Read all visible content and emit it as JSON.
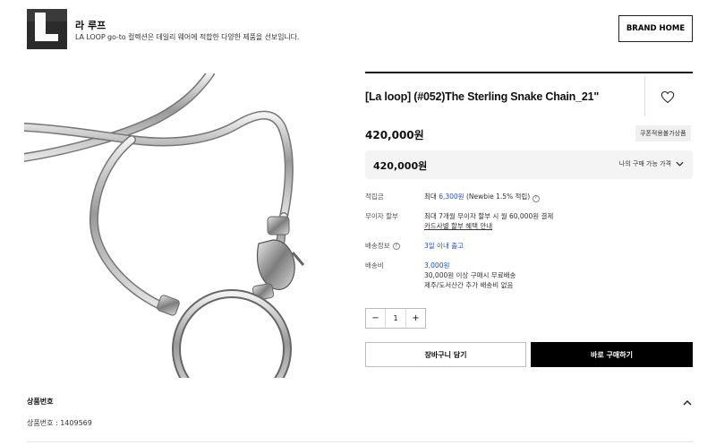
{
  "brand": {
    "name": "라 루프",
    "description": "LA LOOP go-to 컬렉션은 데일리 웨어에 적합한 다양한 제품을 선보입니다.",
    "home_button": "BRAND HOME"
  },
  "product": {
    "title": "[La loop] (#052)The Sterling Snake Chain_21\"",
    "price": "420,000원",
    "coupon_badge": "쿠폰적용불가상품",
    "my_price": "420,000원",
    "my_price_toggle": "나의 구매 가능 가격"
  },
  "details": {
    "points_label": "적립금",
    "points_prefix": "최대 ",
    "points_amount": "6,300원",
    "points_suffix": " (Newbie 1.5% 적립)",
    "installment_label": "무이자 할부",
    "installment_text": "최대 7개월 무이자 할부 시 월 60,000원 결제",
    "installment_link": "카드사별 할부 혜택 안내",
    "shipping_info_label": "배송정보",
    "shipping_info_value": "3일 이내 출고",
    "shipping_fee_label": "배송비",
    "shipping_fee_value": "3,000원",
    "shipping_free_note": "30,000원 이상 구매시 무료배송",
    "shipping_extra_note": "제주/도서산간 추가 배송비 없음"
  },
  "quantity": {
    "minus": "−",
    "value": "1",
    "plus": "+"
  },
  "actions": {
    "cart": "장바구니 담기",
    "buy": "바로 구매하기"
  },
  "product_number": {
    "title": "상품번호",
    "value": "상품번호 : 1409569"
  },
  "icons": [
    "heart-icon",
    "chevron-down-icon",
    "help-icon",
    "chevron-up-icon"
  ],
  "colors": {
    "accent_blue": "#1e4fd6",
    "buy_button": "#000000"
  }
}
